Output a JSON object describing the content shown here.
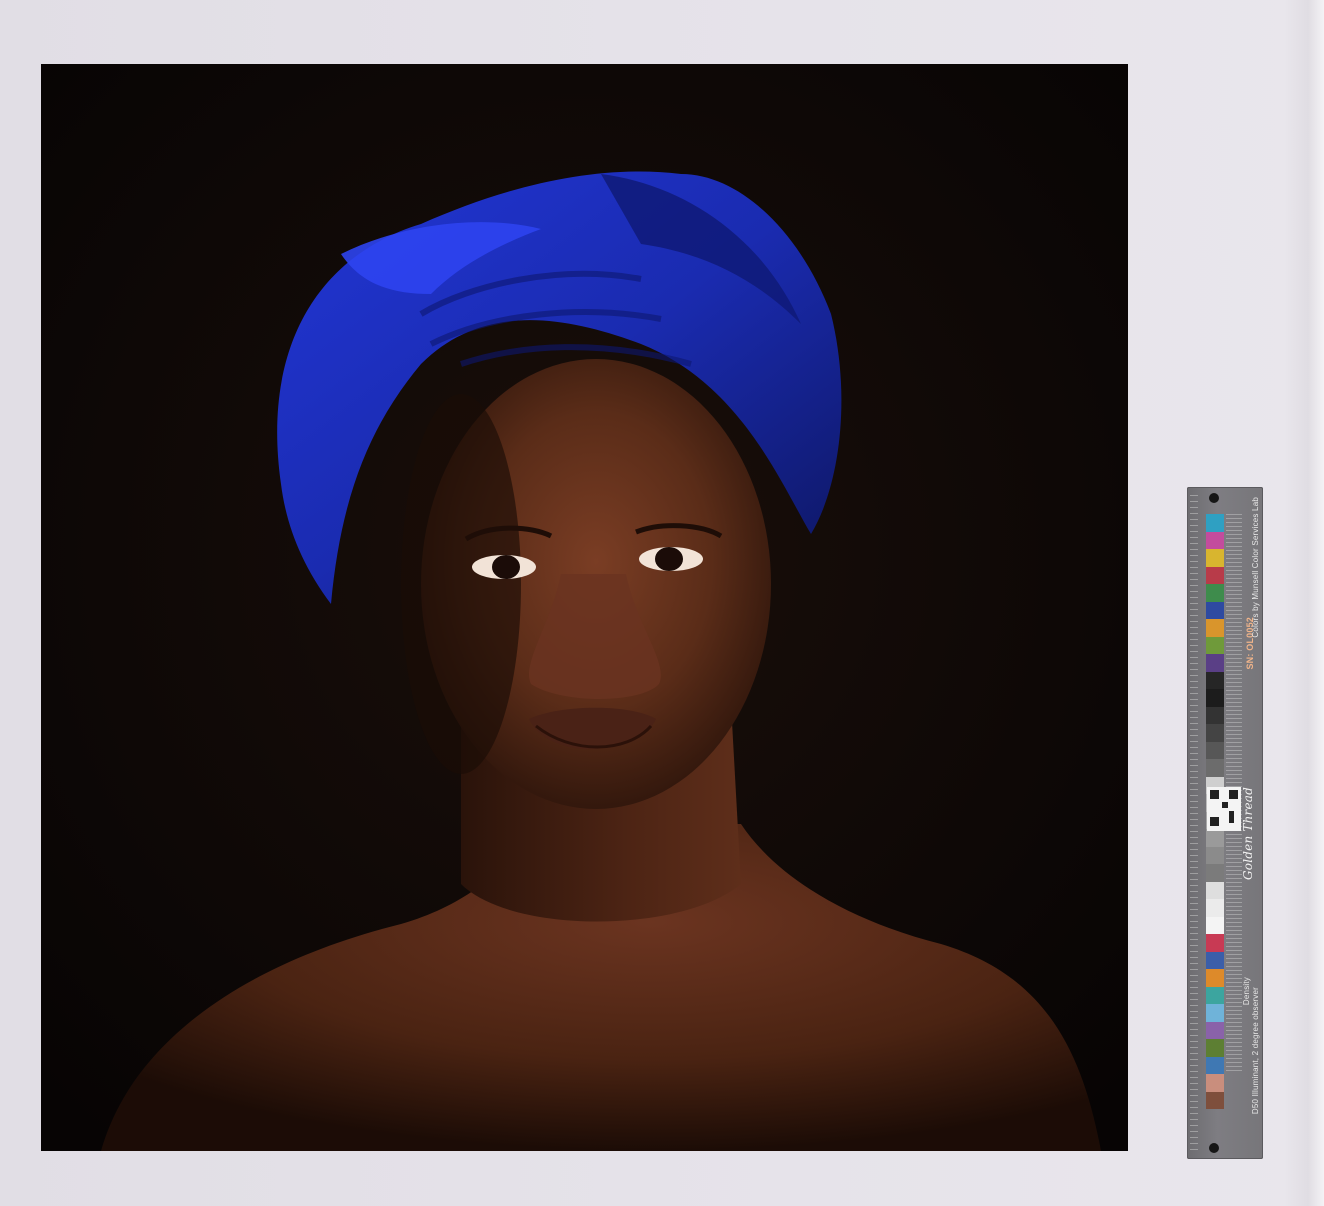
{
  "photograph": {
    "subject": "portrait",
    "colors": {
      "background": "#0e0806",
      "headwrap": "#1b2fbf",
      "skin": "#5a2c18"
    }
  },
  "color_target": {
    "maker_text": "Golden Thread",
    "serial": "SN: OL0052",
    "colors_credit": "Colors by Munsell Color Services Lab",
    "illuminant_note": "D50 Illuminant, 2 degree observer",
    "density_label": "Density",
    "swatch_colors": [
      "#2fa0c2",
      "#c34c9d",
      "#d8b52f",
      "#b83b49",
      "#3e8c4c",
      "#2e4aa1",
      "#d9952c",
      "#6f9a3a",
      "#5a3f86",
      "#262626",
      "#1c1c1c",
      "#333333",
      "#444444",
      "#575757",
      "#6c6c6c",
      "#cfcfcf",
      "#bdbdbd",
      "#a9a9a9",
      "#9a9a9a",
      "#8b8b8b",
      "#7b7b7b",
      "#dedede",
      "#ebebeb",
      "#f4f4f4",
      "#c83a54",
      "#3b5ea9",
      "#dd8a2a",
      "#3ca59f",
      "#6fb3d9",
      "#8a62a9",
      "#5d7f33",
      "#3f78b3",
      "#c98e7d",
      "#7e4f3c"
    ]
  }
}
